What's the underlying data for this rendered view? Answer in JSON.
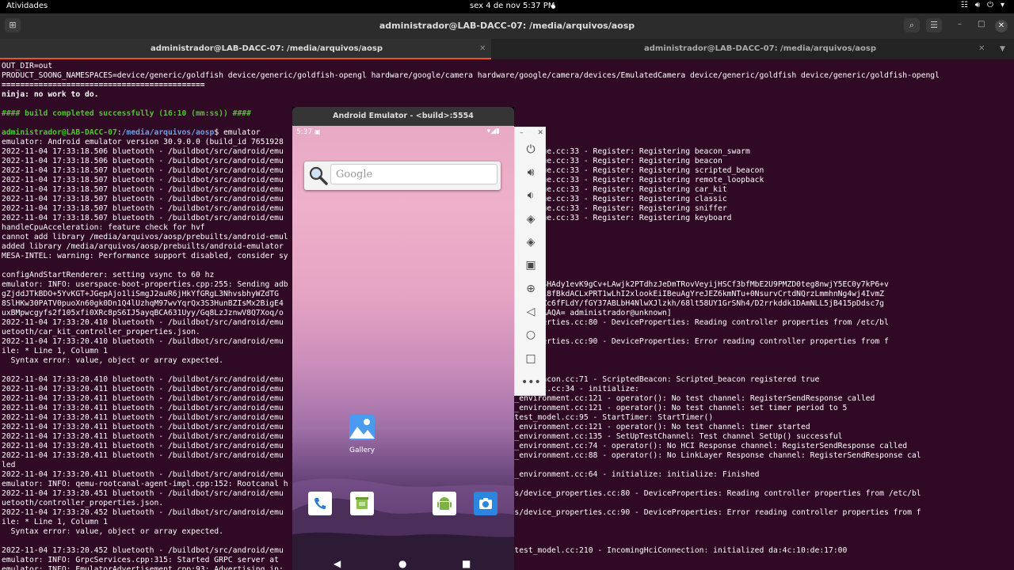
{
  "topbar": {
    "activities": "Atividades",
    "clock": "sex 4 de nov  5:37 PM"
  },
  "terminal": {
    "title": "administrador@LAB-DACC-07: /media/arquivos/aosp",
    "tabs": [
      {
        "label": "administrador@LAB-DACC-07: /media/arquivos/aosp"
      },
      {
        "label": "administrador@LAB-DACC-07: /media/arquivos/aosp"
      }
    ],
    "prompt": {
      "user_host": "administrador@LAB-DACC-07",
      "colon": ":",
      "path": "/media/arquivos/aosp",
      "command": "$ emulator"
    },
    "lines": [
      "OUT_DIR=out",
      "PRODUCT_SOONG_NAMESPACES=device/generic/goldfish device/generic/goldfish-opengl hardware/google/camera hardware/google/camera/devices/EmulatedCamera device/generic/goldfish device/generic/goldfish-opengl",
      "============================================",
      "ninja: no work to do.",
      "",
      "#### build completed successfully (16:10 (mm:ss)) ####",
      "",
      "__PROMPT__",
      "emulator: Android emulator version 30.9.0.0 (build_id 7651928",
      "2022-11-04 17:33:18.506 bluetooth - /buildbot/src/android/emu                                   l/setup/device_boutique.cc:33 - Register: Registering beacon_swarm",
      "2022-11-04 17:33:18.506 bluetooth - /buildbot/src/android/emu                                   l/setup/device_boutique.cc:33 - Register: Registering beacon",
      "2022-11-04 17:33:18.507 bluetooth - /buildbot/src/android/emu                                   l/setup/device_boutique.cc:33 - Register: Registering scripted_beacon",
      "2022-11-04 17:33:18.507 bluetooth - /buildbot/src/android/emu                                   l/setup/device_boutique.cc:33 - Register: Registering remote_loopback",
      "2022-11-04 17:33:18.507 bluetooth - /buildbot/src/android/emu                                   l/setup/device_boutique.cc:33 - Register: Registering car_kit",
      "2022-11-04 17:33:18.507 bluetooth - /buildbot/src/android/emu                                   l/setup/device_boutique.cc:33 - Register: Registering classic",
      "2022-11-04 17:33:18.507 bluetooth - /buildbot/src/android/emu                                   l/setup/device_boutique.cc:33 - Register: Registering sniffer",
      "2022-11-04 17:33:18.507 bluetooth - /buildbot/src/android/emu                                   l/setup/device_boutique.cc:33 - Register: Registering keyboard",
      "handleCpuAcceleration: feature check for hvf",
      "cannot add library /media/arquivos/aosp/prebuilts/android-emul                                  ulkan.so: failed",
      "added library /media/arquivos/aosp/prebuilts/android-emulator",
      "MESA-INTEL: warning: Performance support disabled, consider sy",
      "",
      "configAndStartRenderer: setting vsync to 60 hz",
      "emulator: INFO: userspace-boot-properties.cpp:255: Sending adb                                  hzFuFSJDG0mYmpbknQ6KVSHAdy1evK9gCv+LAwjk2PTdhzJeDmTRovVeyijHSCf3bfMbE2U9PMZD0teg8nwjY5EC0y7kP6+v",
      "gZjddJTkBDO+5YvKGT+JGepAjo1liSmgJ2auR6jHkYfGRgL3NhvsbhyWZdTG                                   5BgWoK2kk+2+MDXGFmk2US18fBkdACLxPRT1wLhI2xlookEiIBeuAgYreJEZ6kmNTu+0NsurvCrtdNQrzLmmhnNg4wj4IvmZ",
      "8SlHKw30PATV0puoXn60gk0Dn1Q4lUzhqM97wvYqrQx3S3HunBZIsMx2BigE4                                  8hahQ4z4UkgCxylO9GaTCiZc6fFLdY/fGY37ABLbH4NlwXJlzkh/68lt58UY1GrSNh4/D2rrkddk1DAmNLL5jB415pDdsc7g",
      "uxBMpwcgyfs2f105xfi0XRc8pS6IJ5ayqBCA631Uyy/Gq8LzJznwV8Q7Xoq/o                                  QDny7mRGrA8y3uqQmAQQgEAAQA= administrador@unknown]",
      "2022-11-04 17:33:20.410 bluetooth - /buildbot/src/android/emu                                   l/devices/device_properties.cc:80 - DeviceProperties: Reading controller properties from /etc/bl",
      "uetooth/car_kit_controller_properties.json.",
      "2022-11-04 17:33:20.410 bluetooth - /buildbot/src/android/emu                                   l/devices/device_properties.cc:90 - DeviceProperties: Error reading controller properties from f",
      "ile: * Line 1, Column 1",
      "  Syntax error: value, object or array expected.",
      "",
      "2022-11-04 17:33:20.410 bluetooth - /buildbot/src/android/emu                                   l/devices/scripted_beacon.cc:71 - ScriptedBeacon: Scripted_beacon registered true",
      "2022-11-04 17:33:20.411 bluetooth - /buildbot/src/android/emu                                   sktop/test_environment.cc:34 - initialize:",
      "2022-11-04 17:33:20.411 bluetooth - /buildbot/src/android/emu                                   ib/desktop/test_environment.cc:121 - operator(): No test channel: RegisterSendResponse called",
      "2022-11-04 17:33:20.411 bluetooth - /buildbot/src/android/emu                                   ib/desktop/test_environment.cc:121 - operator(): No test channel: set timer period to 5",
      "2022-11-04 17:33:20.411 bluetooth - /buildbot/src/android/emu                                   ib/model/setup/test_model.cc:95 - StartTimer: StartTimer()",
      "2022-11-04 17:33:20.411 bluetooth - /buildbot/src/android/emu                                   ib/desktop/test_environment.cc:121 - operator(): No test channel: timer started",
      "2022-11-04 17:33:20.411 bluetooth - /buildbot/src/android/emu                                   ib/desktop/test_environment.cc:135 - SetUpTestChannel: Test channel SetUp() successful",
      "2022-11-04 17:33:20.411 bluetooth - /buildbot/src/android/emu                                   ib/desktop/test_environment.cc:74 - operator(): No HCI Response channel: RegisterSendResponse called",
      "2022-11-04 17:33:20.411 bluetooth - /buildbot/src/android/emu                                   ib/desktop/test_environment.cc:88 - operator(): No LinkLayer Response channel: RegisterSendResponse cal",
      "led",
      "2022-11-04 17:33:20.411 bluetooth - /buildbot/src/android/emu                                   ib/desktop/test_environment.cc:64 - initialize: initialize: Finished",
      "emulator: INFO: qemu-rootcanal-agent-impl.cpp:152: Rootcanal h",
      "2022-11-04 17:33:20.451 bluetooth - /buildbot/src/android/emu                                   ib/model/devices/device_properties.cc:80 - DeviceProperties: Reading controller properties from /etc/bl",
      "uetooth/controller_properties.json.",
      "2022-11-04 17:33:20.452 bluetooth - /buildbot/src/android/emu                                   ib/model/devices/device_properties.cc:90 - DeviceProperties: Error reading controller properties from f",
      "ile: * Line 1, Column 1",
      "  Syntax error: value, object or array expected.",
      "",
      "2022-11-04 17:33:20.452 bluetooth - /buildbot/src/android/emu                                   ib/model/setup/test_model.cc:210 - IncomingHciConnection: initialized da:4c:10:de:17:00",
      "emulator: INFO: GrpcServices.cpp:315: Started GRPC server at",
      "emulator: INFO: EmulatorAdvertisement.cpp:93: Advertising in:"
    ]
  },
  "emulator": {
    "title": "Android Emulator - <build>:5554",
    "status_time": "5:37",
    "search_placeholder": "Google",
    "gallery_label": "Gallery"
  },
  "colors": {
    "terminal_bg": "#300a24",
    "prompt_user": "#4cc730",
    "prompt_path": "#6f9fe0",
    "tab_accent": "#e95420"
  }
}
